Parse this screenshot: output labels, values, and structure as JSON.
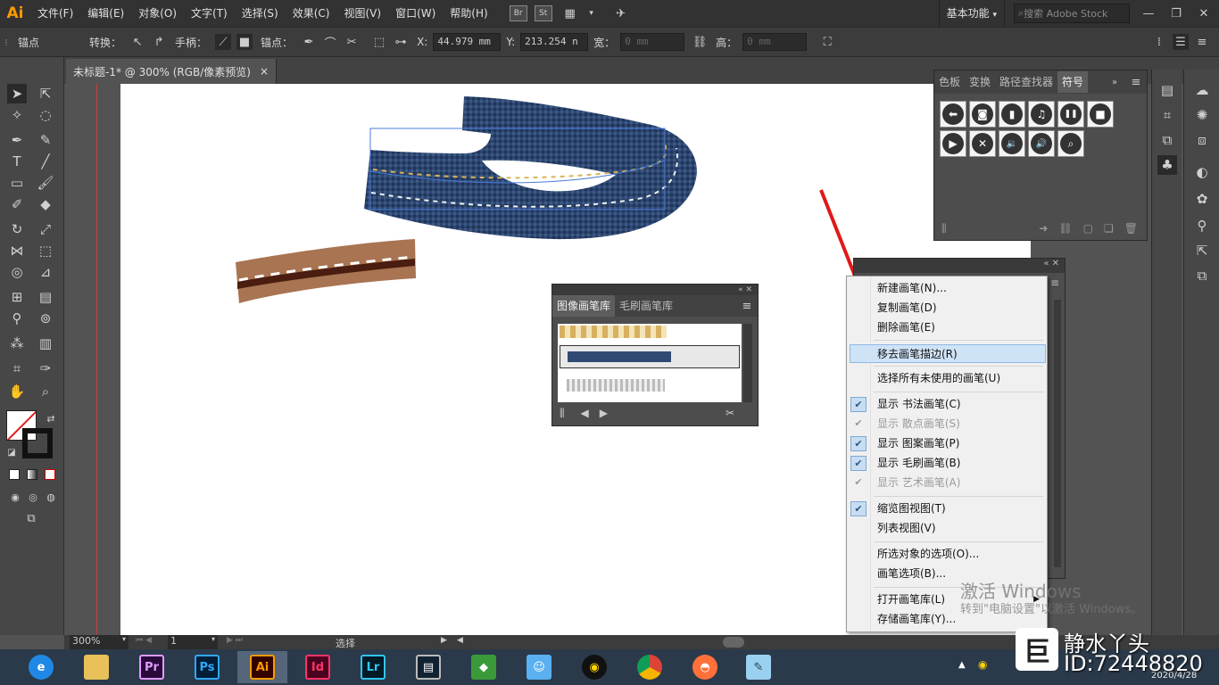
{
  "app": {
    "logo": "Ai",
    "menu": [
      "文件(F)",
      "编辑(E)",
      "对象(O)",
      "文字(T)",
      "选择(S)",
      "效果(C)",
      "视图(V)",
      "窗口(W)",
      "帮助(H)"
    ],
    "br_label": "Br",
    "st_label": "St",
    "workspace": "基本功能",
    "search_placeholder": "搜索 Adobe Stock"
  },
  "control_bar": {
    "anchor_label": "锚点",
    "convert_label": "转换：",
    "handle_label": "手柄：",
    "anchor_point_label": "锚点：",
    "x_label": "X:",
    "x_value": "44.979 mm",
    "y_label": "Y:",
    "y_value": "213.254 n",
    "w_label": "宽：",
    "w_value": "0 mm",
    "h_label": "高：",
    "h_value": "0 mm"
  },
  "document": {
    "tab_title": "未标题-1* @ 300% (RGB/像素预览)",
    "close_glyph": "×"
  },
  "symbols_panel": {
    "tabs": [
      "色板",
      "变换",
      "路径查找器",
      "符号"
    ],
    "active_tab": "符号",
    "symbols": [
      "⬅",
      "◙",
      "▮",
      "♫",
      "❚❚",
      "■",
      "▶",
      "✕",
      "🔉",
      "🔊",
      "⌕"
    ]
  },
  "brush_library_panel": {
    "tabs": [
      "图像画笔库",
      "毛刷画笔库"
    ],
    "active_tab": "图像画笔库"
  },
  "context_menu": {
    "items": [
      {
        "label": "新建画笔(N)...",
        "check": "none"
      },
      {
        "label": "复制画笔(D)",
        "check": "none"
      },
      {
        "label": "删除画笔(E)",
        "check": "none"
      },
      {
        "label": "移去画笔描边(R)",
        "check": "none",
        "highlight": true
      },
      {
        "label": "选择所有未使用的画笔(U)",
        "check": "none"
      },
      {
        "label": "显示 书法画笔(C)",
        "check": "on"
      },
      {
        "label": "显示 散点画笔(S)",
        "check": "dim",
        "disabled": true
      },
      {
        "label": "显示 图案画笔(P)",
        "check": "on"
      },
      {
        "label": "显示 毛刷画笔(B)",
        "check": "on"
      },
      {
        "label": "显示 艺术画笔(A)",
        "check": "dim",
        "disabled": true
      },
      {
        "label": "缩览图视图(T)",
        "check": "on"
      },
      {
        "label": "列表视图(V)",
        "check": "none"
      },
      {
        "label": "所选对象的选项(O)...",
        "check": "none"
      },
      {
        "label": "画笔选项(B)...",
        "check": "none"
      },
      {
        "label": "打开画笔库(L)",
        "check": "none",
        "submenu": true
      },
      {
        "label": "存储画笔库(Y)...",
        "check": "none"
      }
    ]
  },
  "status_bar": {
    "zoom": "300%",
    "artboard_num": "1",
    "tool_label": "选择"
  },
  "watermark": {
    "line1": "激活 Windows",
    "line2": "转到\"电脑设置\"以激活 Windows。",
    "brand": "静水丫头",
    "id": "ID:72448820",
    "date": "2020/4/28"
  },
  "taskbar": {
    "apps": [
      "ie",
      "explorer",
      "Pr",
      "Ps",
      "Ai",
      "Id",
      "Lr",
      "video",
      "game",
      "qq-cat",
      "qq",
      "chrome",
      "firefox",
      "notes"
    ]
  },
  "colors": {
    "accent_arrow": "#e0191a",
    "denim": "#2e4a72",
    "leather": "#a06848"
  }
}
